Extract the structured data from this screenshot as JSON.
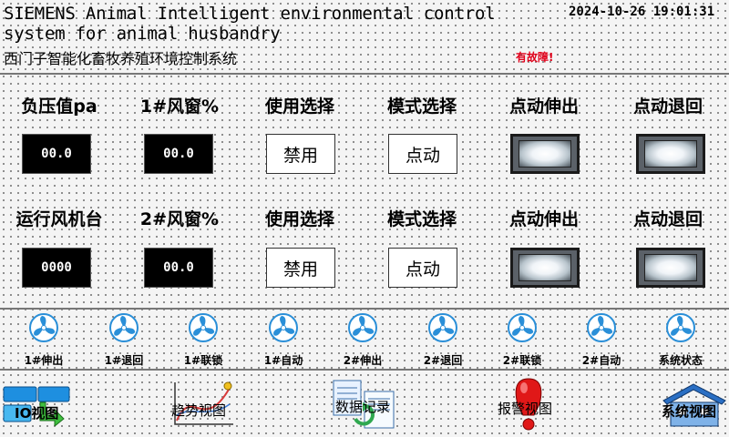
{
  "header": {
    "title_en_line1": "SIEMENS Animal Intelligent environmental control",
    "title_en_line2": "system for animal husbandry",
    "title_cn": "西门子智能化畜牧养殖环境控制系统",
    "datetime": "2024-10-26 19:01:31",
    "fault_text": "有故障!"
  },
  "row1": {
    "labels": [
      "负压值pa",
      "1#风窗%",
      "使用选择",
      "模式选择",
      "点动伸出",
      "点动退回"
    ],
    "pressure_value": "00.0",
    "window1_value": "00.0",
    "use_select": "禁用",
    "mode_select": "点动"
  },
  "row2": {
    "labels": [
      "运行风机台",
      "2#风窗%",
      "使用选择",
      "模式选择",
      "点动伸出",
      "点动退回"
    ],
    "fans_running_value": "0000",
    "window2_value": "00.0",
    "use_select": "禁用",
    "mode_select": "点动"
  },
  "status": {
    "items": [
      {
        "label": "1#伸出",
        "icon": "fan-icon"
      },
      {
        "label": "1#退回",
        "icon": "fan-icon"
      },
      {
        "label": "1#联锁",
        "icon": "fan-icon"
      },
      {
        "label": "1#自动",
        "icon": "fan-icon"
      },
      {
        "label": "2#伸出",
        "icon": "fan-icon"
      },
      {
        "label": "2#退回",
        "icon": "fan-icon"
      },
      {
        "label": "2#联锁",
        "icon": "fan-icon"
      },
      {
        "label": "2#自动",
        "icon": "fan-icon"
      },
      {
        "label": "系统状态",
        "icon": "fan-icon"
      }
    ],
    "fan_color": "#2a8fd8"
  },
  "nav": {
    "io_view": "IO视图",
    "trend_view": "趋势视图",
    "data_log": "数据记录",
    "alarm_view": "报警视图",
    "system_view": "系统视图"
  },
  "colors": {
    "fault": "#e0001a",
    "display_bg": "#000000",
    "display_fg": "#ffffff"
  }
}
